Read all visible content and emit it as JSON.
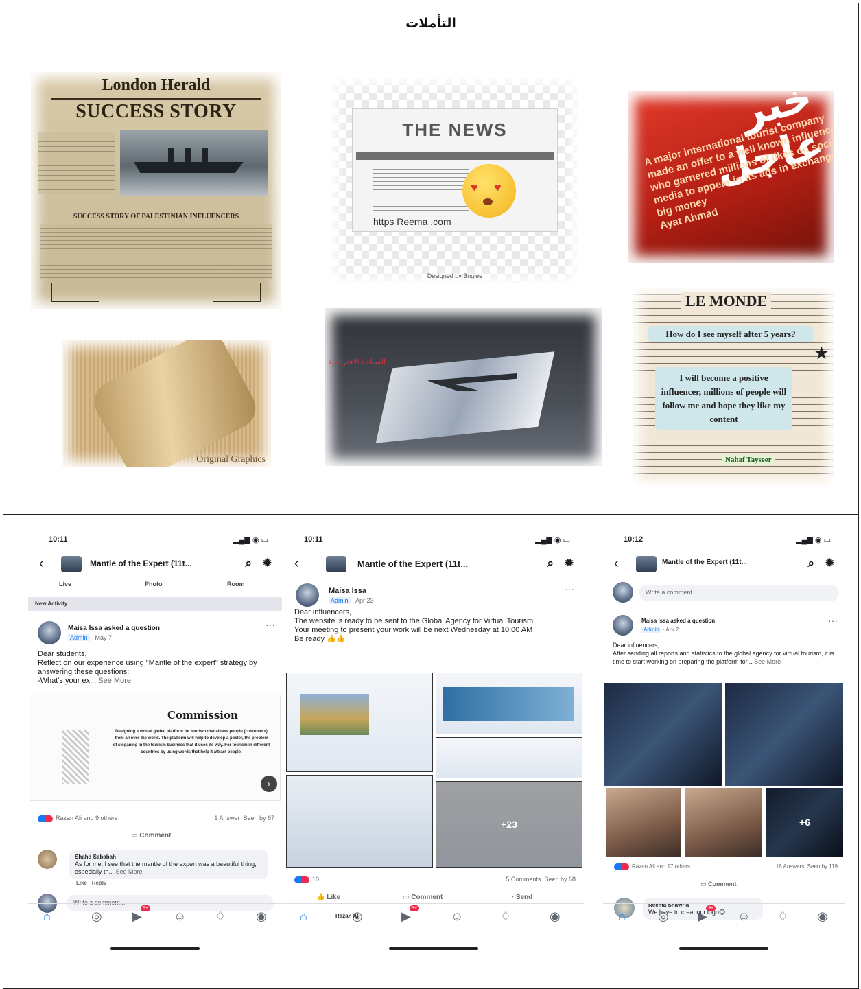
{
  "document": {
    "title": "التأملات"
  },
  "collage": {
    "newspaper1": {
      "masthead": "London Herald",
      "headline": "SUCCESS STORY",
      "subheadline": "SUCCESS STORY OF PALESTINIAN INFLUENCERS"
    },
    "news_card": {
      "title": "THE NEWS",
      "url": "https Reema .com",
      "credit": "Designed by Bnglee"
    },
    "breaking_card": {
      "heading_ar": "خبر عاجل",
      "message": "A major international tourist company made an offer to a well known influencer who garnered millions of likes on social media to appear in its ads in exchange for big money",
      "author": "Ayat Ahmad"
    },
    "rolled_paper": {
      "caption": "Original Graphics"
    },
    "airplane_card": {
      "red_text": "السياحة الافتراضية"
    },
    "monde_card": {
      "masthead": "LE MONDE",
      "question": "How do I see myself after 5 years?",
      "answer": "I will become a positive influencer, millions of people will follow me and hope they like my content",
      "signature": "Nahaf Tayseer"
    }
  },
  "phones": [
    {
      "time": "10:11",
      "group": "Mantle of the Expert (11t...",
      "subnav": [
        "Live",
        "Photo",
        "Room"
      ],
      "activity_label": "New Activity",
      "author": "Maisa Issa asked a question",
      "role": "Admin",
      "date": "May 7",
      "text": "Dear students,\nReflect on our experience using  \"Mantle of the expert\" strategy by answering these questions:\n-What's your ex...",
      "see_more": "See More",
      "card_title": "Commission",
      "card_body": "Designing a virtual global platform for tourism that allows people (customers) from all over the world. The platform will help to develop a poster, the problem of sloganing in the tourism business that it uses its way. For tourism in different countries by using words that help it attract people.",
      "reactions": "Razan Ali and 9 others",
      "answers": "1 Answer",
      "seen": "Seen by 67",
      "comment_label": "Comment",
      "commenter": "Shahd Sababah",
      "comment": "As for me, I see that the mantle of the expert was a beautiful thing, especially th...",
      "comment_see_more": "See More",
      "like": "Like",
      "reply": "Reply",
      "write_comment": "Write a comment...",
      "badge": "9+"
    },
    {
      "time": "10:11",
      "group": "Mantle of the Expert (11t...",
      "author": "Maisa Issa",
      "role": "Admin",
      "date": "Apr 23",
      "text": "Dear influencers,\nThe website is ready to be sent to the Global Agency for Virtual Tourism .\nYour meeting to present your work will be next Wednesday at 10:00 AM\nBe ready 👍👍",
      "reaction_count": "10",
      "comments": "5 Comments",
      "seen": "Seen by 68",
      "plus_count": "+23",
      "like": "Like",
      "comment_label": "Comment",
      "send": "Send",
      "next_author": "Razan Ali",
      "badge": "9+"
    },
    {
      "time": "10:12",
      "group": "Mantle of the Expert (11t...",
      "write_comment": "Write a comment...",
      "author": "Maisa Issa asked a question",
      "role": "Admin",
      "date": "Apr 2",
      "text": "Dear influencers,\nAfter sending all reports and statistics to the global agency for virtual tourism, it is time to start working on preparing the platform for...",
      "see_more": "See More",
      "plus_count": "+6",
      "reactions": "Razan Ali and 17 others",
      "answers": "18 Answers",
      "seen": "Seen by 119",
      "comment_label": "Comment",
      "commenter": "Reema Shawria",
      "comment": "We have to creat our logo😊",
      "badge": "9+"
    }
  ]
}
